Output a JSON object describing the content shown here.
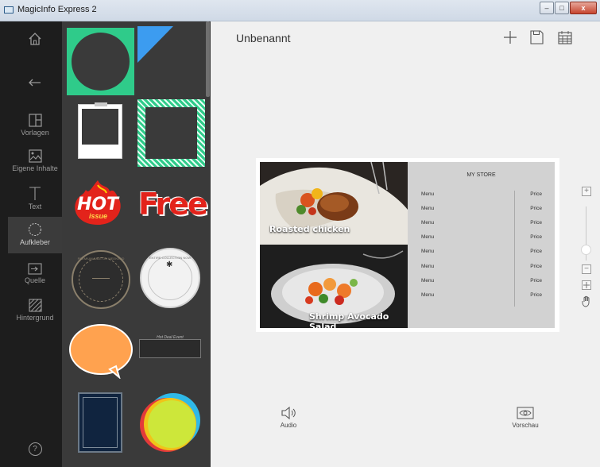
{
  "window": {
    "title": "MagicInfo Express 2",
    "min": "–",
    "max": "□",
    "close": "x"
  },
  "nav": {
    "items": [
      {
        "label": "Vorlagen"
      },
      {
        "label": "Eigene Inhalte"
      },
      {
        "label": "Text"
      },
      {
        "label": "Aufkleber"
      },
      {
        "label": "Quelle"
      },
      {
        "label": "Hintergrund"
      }
    ],
    "help": "?"
  },
  "stickers": {
    "hot_text": "HOT",
    "issue_text": "issue",
    "free_text": "Free",
    "badge1_text": "PREMIUM SALE ON WEEKEND",
    "badge2_text": "ENTIRE COLLECTION NOW",
    "banner_text": "Hot Deal Event"
  },
  "document": {
    "title": "Unbenannt"
  },
  "template": {
    "captions": [
      "Roasted chicken",
      "Shrimp Avocado Salad"
    ],
    "store_name": "MY STORE",
    "rows": [
      {
        "menu": "Menu",
        "price": "Price"
      },
      {
        "menu": "Menu",
        "price": "Price"
      },
      {
        "menu": "Menu",
        "price": "Price"
      },
      {
        "menu": "Menu",
        "price": "Price"
      },
      {
        "menu": "Menu",
        "price": "Price"
      },
      {
        "menu": "Menu",
        "price": "Price"
      },
      {
        "menu": "Menu",
        "price": "Price"
      },
      {
        "menu": "Menu",
        "price": "Price"
      }
    ]
  },
  "zoom": {
    "plus": "+",
    "minus": "−",
    "level": 0.2
  },
  "bottom": {
    "audio": "Audio",
    "preview": "Vorschau"
  },
  "colors": {
    "accent_green": "#2fcb8a",
    "accent_blue": "#3c9cf0",
    "hot_red": "#e3231b"
  }
}
